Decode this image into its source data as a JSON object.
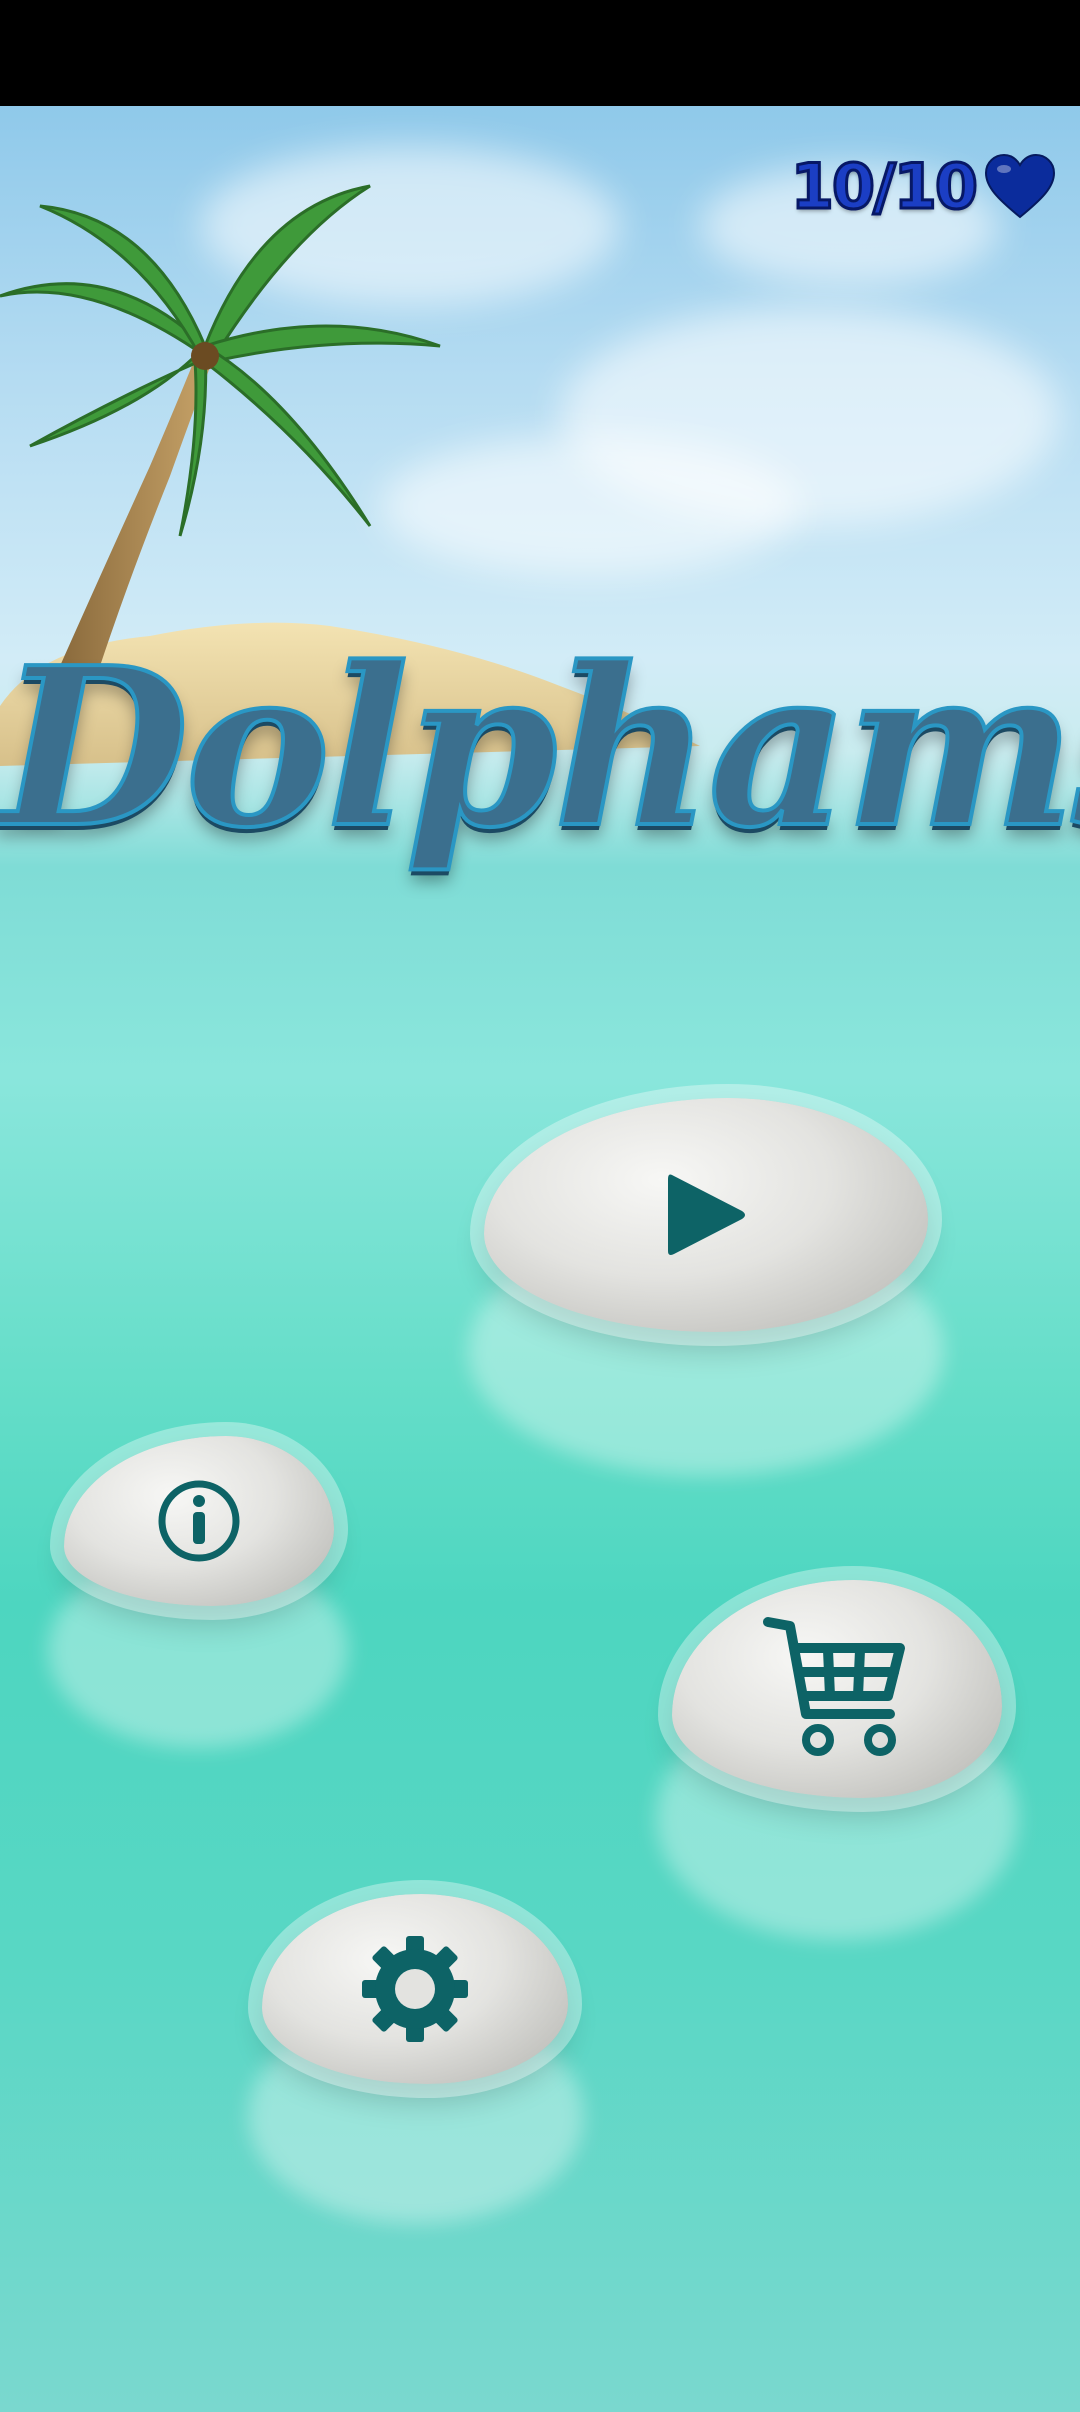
{
  "game": {
    "title": "Dolphams"
  },
  "hud": {
    "lives": "10/10",
    "heart_color": "#0b2c9c"
  },
  "menu": [
    {
      "id": "play",
      "icon": "play-icon"
    },
    {
      "id": "info",
      "icon": "info-icon"
    },
    {
      "id": "shop",
      "icon": "cart-icon"
    },
    {
      "id": "settings",
      "icon": "gear-icon"
    }
  ],
  "colors": {
    "icon": "#0d6366",
    "title_fill": "#3b6f8e",
    "title_outline": "#2a97c4"
  }
}
